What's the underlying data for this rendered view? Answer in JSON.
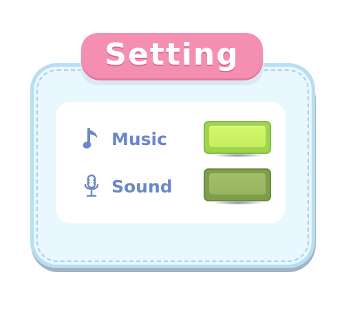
{
  "dialog": {
    "title": "Setting",
    "colors": {
      "banner": "#f58fb2",
      "panel_border": "#b7def3",
      "panel_fill": "#e8f8fe",
      "label": "#6b87c9",
      "toggle_on": "#c6ee5a",
      "toggle_off": "#9ab660"
    }
  },
  "settings": [
    {
      "label": "Music",
      "icon": "music-note-icon",
      "enabled": true
    },
    {
      "label": "Sound",
      "icon": "microphone-icon",
      "enabled": false
    }
  ]
}
